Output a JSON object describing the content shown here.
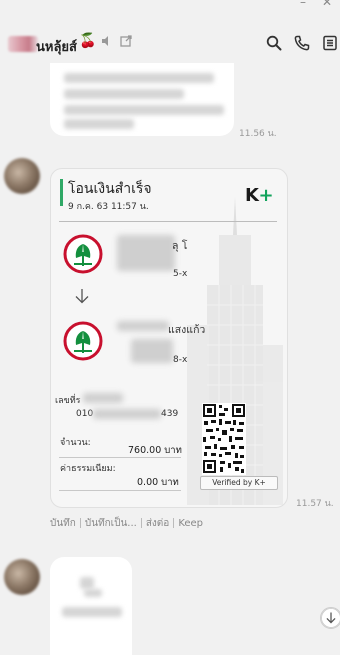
{
  "window": {
    "minimize_glyph": "–",
    "close_glyph": "✕"
  },
  "header": {
    "chat_name": "นหลุ้ยส์",
    "cherry_glyph": "🍒",
    "icons": [
      "mute-icon",
      "popout-icon",
      "search-icon",
      "phone-icon",
      "menu-icon"
    ]
  },
  "messages": {
    "first_time": "11.56 น.",
    "slip": {
      "title": "โอนเงินสำเร็จ",
      "date": "9 ก.ค. 63  11:57 น.",
      "logo_text": "K",
      "logo_plus": "+",
      "from_name_tail": "ลุ โ",
      "from_account_tail": "5-x",
      "to_name_tail": "แสงแก้ว",
      "to_account_tail": "8-x",
      "ref_label": "เลขที่ร",
      "ref_value_head": "010",
      "ref_value_tail": "439",
      "amount_label": "จำนวน:",
      "amount_value": "760.00 บาท",
      "fee_label": "ค่าธรรมเนียม:",
      "fee_value": "0.00 บาท",
      "verified": "Verified by K+"
    },
    "slip_time": "11.57 น.",
    "actions": [
      "บันทึก",
      "บันทึกเป็น...",
      "ส่งต่อ",
      "Keep"
    ]
  },
  "colors": {
    "accent_green": "#2fa866",
    "kbank_green": "#138f3e",
    "kbank_red": "#c8102e"
  }
}
